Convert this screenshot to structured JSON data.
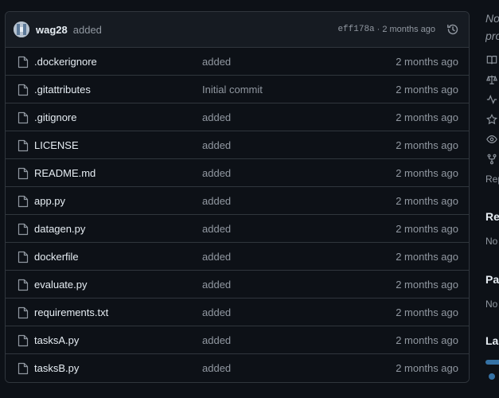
{
  "commit": {
    "author": "wag28",
    "message": "added",
    "sha": "eff178a",
    "separator": "·",
    "age": "2 months ago"
  },
  "files": [
    {
      "name": ".dockerignore",
      "message": "added",
      "age": "2 months ago"
    },
    {
      "name": ".gitattributes",
      "message": "Initial commit",
      "age": "2 months ago"
    },
    {
      "name": ".gitignore",
      "message": "added",
      "age": "2 months ago"
    },
    {
      "name": "LICENSE",
      "message": "added",
      "age": "2 months ago"
    },
    {
      "name": "README.md",
      "message": "added",
      "age": "2 months ago"
    },
    {
      "name": "app.py",
      "message": "added",
      "age": "2 months ago"
    },
    {
      "name": "datagen.py",
      "message": "added",
      "age": "2 months ago"
    },
    {
      "name": "dockerfile",
      "message": "added",
      "age": "2 months ago"
    },
    {
      "name": "evaluate.py",
      "message": "added",
      "age": "2 months ago"
    },
    {
      "name": "requirements.txt",
      "message": "added",
      "age": "2 months ago"
    },
    {
      "name": "tasksA.py",
      "message": "added",
      "age": "2 months ago"
    },
    {
      "name": "tasksB.py",
      "message": "added",
      "age": "2 months ago"
    }
  ],
  "sidebar": {
    "about_line1": "No",
    "about_line2": "pro",
    "icons": [
      "book-icon",
      "law-icon",
      "pulse-icon",
      "star-icon",
      "eye-icon",
      "fork-icon"
    ],
    "report_text": "Rep",
    "releases_heading": "Rel",
    "releases_text": "No",
    "packages_heading": "Pac",
    "packages_text": "No",
    "languages_heading": "Lan"
  },
  "colors": {
    "background": "#0d1117",
    "header_bg": "#161b22",
    "border": "#30363d",
    "muted_text": "#9198a1",
    "primary_text": "#e6edf3",
    "python_color": "#3572a5"
  }
}
